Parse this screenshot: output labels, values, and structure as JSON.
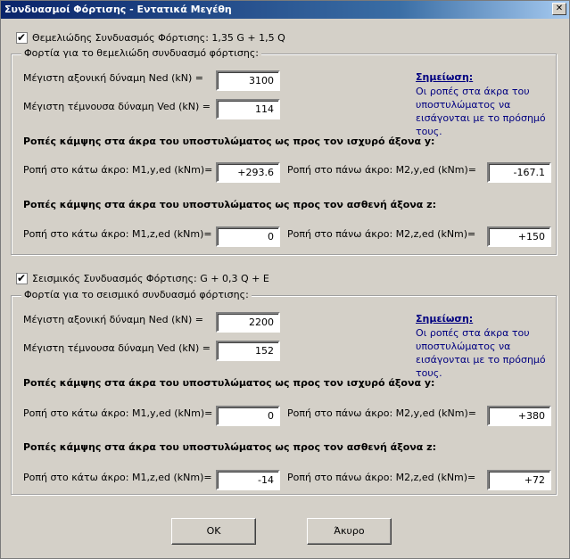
{
  "window": {
    "title": "Συνδυασμοί Φόρτισης - Εντατικά Μεγέθη",
    "close_glyph": "✕"
  },
  "fundamental": {
    "checkbox_label": "Θεμελιώδης Συνδυασμός Φόρτισης: 1,35 G + 1,5 Q",
    "checked_glyph": "✔",
    "group_label": "Φορτία για το θεμελιώδη συνδυασμό φόρτισης:",
    "ned_label": "Μέγιστη αξονική δύναμη Ned (kN) =",
    "ned_value": "3100",
    "ved_label": "Μέγιστη τέμνουσα δύναμη Ved (kN) =",
    "ved_value": "114",
    "note_title": "Σημείωση:",
    "note_text": "Οι ροπές στα άκρα του υποστυλώματος να εισάγονται με το πρόσημό τους.",
    "strong_axis_heading": "Ροπές κάμψης στα άκρα του υποστυλώματος ως προς τον ισχυρό άξονα y:",
    "m1y_label": "Ροπή στο κάτω άκρο: M1,y,ed (kNm)=",
    "m1y_value": "+293.6",
    "m2y_label": "Ροπή στο πάνω άκρο: M2,y,ed (kNm)=",
    "m2y_value": "-167.1",
    "weak_axis_heading": "Ροπές κάμψης στα άκρα του υποστυλώματος ως προς τον ασθενή άξονα z:",
    "m1z_label": "Ροπή στο κάτω άκρο: M1,z,ed (kNm)=",
    "m1z_value": "0",
    "m2z_label": "Ροπή στο πάνω άκρο: M2,z,ed (kNm)=",
    "m2z_value": "+150"
  },
  "seismic": {
    "checkbox_label": "Σεισμικός Συνδυασμός Φόρτισης: G + 0,3 Q + E",
    "checked_glyph": "✔",
    "group_label": "Φορτία για το σεισμικό συνδυασμό φόρτισης:",
    "ned_label": "Μέγιστη αξονική δύναμη Ned (kN) =",
    "ned_value": "2200",
    "ved_label": "Μέγιστη τέμνουσα δύναμη Ved (kN) =",
    "ved_value": "152",
    "note_title": "Σημείωση:",
    "note_text": "Οι ροπές στα άκρα του υποστυλώματος να εισάγονται με το πρόσημό τους.",
    "strong_axis_heading": "Ροπές κάμψης στα άκρα του υποστυλώματος ως προς τον ισχυρό άξονα y:",
    "m1y_label": "Ροπή στο κάτω άκρο: M1,y,ed (kNm)=",
    "m1y_value": "0",
    "m2y_label": "Ροπή στο πάνω άκρο: M2,y,ed (kNm)=",
    "m2y_value": "+380",
    "weak_axis_heading": "Ροπές κάμψης στα άκρα του υποστυλώματος ως προς τον ασθενή άξονα z:",
    "m1z_label": "Ροπή στο κάτω άκρο: M1,z,ed (kNm)=",
    "m1z_value": "-14",
    "m2z_label": "Ροπή στο πάνω άκρο: M2,z,ed (kNm)=",
    "m2z_value": "+72"
  },
  "buttons": {
    "ok": "OK",
    "cancel": "Άκυρο"
  }
}
